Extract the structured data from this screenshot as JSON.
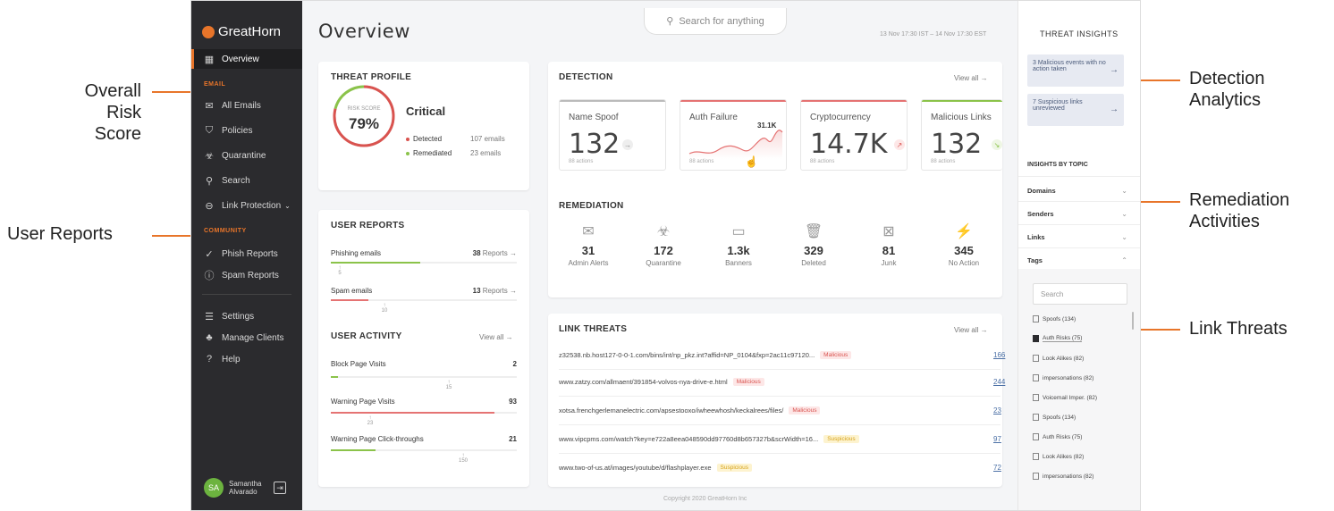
{
  "callouts": {
    "overall_risk": [
      "Overall",
      "Risk Score"
    ],
    "user_reports": "User Reports",
    "detection": [
      "Detection",
      "Analytics"
    ],
    "remediation": [
      "Remediation",
      "Activities"
    ],
    "link_threats": "Link Threats"
  },
  "colors": {
    "accent": "#e8752a",
    "critical": "#d9534f",
    "remediated": "#8bc34a",
    "sidebar": "#2b2b2e"
  },
  "sidebar": {
    "brand": "GreatHorn",
    "overview": "Overview",
    "email_label": "EMAIL",
    "items": [
      {
        "label": "All Emails",
        "icon": "mail-icon"
      },
      {
        "label": "Policies",
        "icon": "shield-icon"
      },
      {
        "label": "Quarantine",
        "icon": "biohazard-icon"
      },
      {
        "label": "Search",
        "icon": "search-icon"
      },
      {
        "label": "Link Protection",
        "icon": "link-icon"
      }
    ],
    "community_label": "COMMUNITY",
    "community_items": [
      {
        "label": "Phish Reports",
        "icon": "hook-icon"
      },
      {
        "label": "Spam Reports",
        "icon": "alert-icon"
      }
    ],
    "bottom_items": [
      {
        "label": "Settings",
        "icon": "sliders-icon"
      },
      {
        "label": "Manage Clients",
        "icon": "org-icon"
      },
      {
        "label": "Help",
        "icon": "help-icon"
      }
    ],
    "user": {
      "initials": "SA",
      "first": "Samantha",
      "last": "Alvarado"
    }
  },
  "header": {
    "title": "Overview",
    "search_placeholder": "Search for anything",
    "date_range": "13 Nov 17:30 IST – 14 Nov 17:30 EST"
  },
  "threat_profile": {
    "title": "THREAT PROFILE",
    "risk_label": "RISK SCORE",
    "risk_value": "79%",
    "risk_fraction": 0.79,
    "level": "Critical",
    "detected_label": "Detected",
    "detected_value": "107 emails",
    "remediated_label": "Remediated",
    "remediated_value": "23 emails"
  },
  "user_reports": {
    "title": "USER REPORTS",
    "rows": [
      {
        "label": "Phishing emails",
        "count": "38",
        "suffix": "Reports →",
        "marker": "5",
        "fill": 0.48,
        "color": "#8bc34a"
      },
      {
        "label": "Spam emails",
        "count": "13",
        "suffix": "Reports →",
        "marker": "10",
        "fill": 0.2,
        "color": "#e57373"
      }
    ]
  },
  "user_activity": {
    "title": "USER ACTIVITY",
    "view_all": "View all →",
    "rows": [
      {
        "label": "Block Page Visits",
        "value": "2",
        "marker": "15",
        "fill": 0.04,
        "color": "#8bc34a"
      },
      {
        "label": "Warning Page Visits",
        "value": "93",
        "marker": "23",
        "fill": 0.88,
        "color": "#e57373"
      },
      {
        "label": "Warning Page Click-throughs",
        "value": "21",
        "marker": "150",
        "fill": 0.24,
        "color": "#8bc34a"
      }
    ]
  },
  "detection": {
    "title": "DETECTION",
    "view_all": "View all →",
    "tiles": [
      {
        "name": "Name Spoof",
        "value": "132",
        "actions": "88 actions",
        "bar": "#bbbbbb",
        "arrow": "→",
        "arrow_color": "#888"
      },
      {
        "name": "Auth Failure",
        "value": "31.1K",
        "actions": "88 actions",
        "bar": "#e57373",
        "arrow": "",
        "arrow_color": "#e57373"
      },
      {
        "name": "Cryptocurrency",
        "value": "14.7K",
        "actions": "88 actions",
        "bar": "#e57373",
        "arrow": "↗",
        "arrow_color": "#e57373"
      },
      {
        "name": "Malicious Links",
        "value": "132",
        "actions": "88 actions",
        "bar": "#8bc34a",
        "arrow": "↘",
        "arrow_color": "#8bc34a"
      }
    ]
  },
  "remediation": {
    "title": "REMEDIATION",
    "items": [
      {
        "value": "31",
        "label": "Admin Alerts",
        "icon": "alert-mail-icon",
        "glyph": "✉"
      },
      {
        "value": "172",
        "label": "Quarantine",
        "icon": "biohazard-icon",
        "glyph": "☣"
      },
      {
        "value": "1.3k",
        "label": "Banners",
        "icon": "banner-icon",
        "glyph": "▭"
      },
      {
        "value": "329",
        "label": "Deleted",
        "icon": "trash-icon",
        "glyph": "🗑"
      },
      {
        "value": "81",
        "label": "Junk",
        "icon": "junk-icon",
        "glyph": "⊠"
      },
      {
        "value": "345",
        "label": "No Action",
        "icon": "bolt-icon",
        "glyph": "⚡"
      }
    ]
  },
  "link_threats": {
    "title": "LINK THREATS",
    "view_all": "View all →",
    "rows": [
      {
        "url": "z32538.nb.host127-0-0-1.com/bins/int/np_pkz.int?affid=NP_0104&fxp=2ac11c97120...",
        "tag": "Malicious",
        "kind": "mal",
        "count": "166"
      },
      {
        "url": "www.zatzy.com/allmaent/391854-volvos-nya-drive-e.html",
        "tag": "Malicious",
        "kind": "mal",
        "count": "244"
      },
      {
        "url": "xotsa.frenchgerlemanelectric.com/apsestooxo/iwheewhosh/keckalrees/files/",
        "tag": "Malicious",
        "kind": "mal",
        "count": "23"
      },
      {
        "url": "www.vipcpms.com/watch?key=e722a8eea048590dd97760d8b657327b&scrWidth=16...",
        "tag": "Suspicious",
        "kind": "sus",
        "count": "97"
      },
      {
        "url": "www.two-of-us.at/images/youtube/d/flashplayer.exe",
        "tag": "Suspicious",
        "kind": "sus",
        "count": "72"
      }
    ]
  },
  "insights": {
    "title": "THREAT INSIGHTS",
    "cards": [
      {
        "text": "3 Malicious events with no action taken"
      },
      {
        "text": "7 Suspicious links unreviewed"
      }
    ],
    "by_topic": "INSIGHTS BY TOPIC",
    "topics": [
      {
        "label": "Domains",
        "chev": "⌄"
      },
      {
        "label": "Senders",
        "chev": "⌄"
      },
      {
        "label": "Links",
        "chev": "⌄"
      },
      {
        "label": "Tags",
        "chev": "⌃"
      }
    ],
    "tag_search": "Search",
    "tags": [
      {
        "label": "Spoofs (134)",
        "checked": false
      },
      {
        "label": "Auth Risks (75)",
        "checked": true
      },
      {
        "label": "Look Alikes (82)",
        "checked": false
      },
      {
        "label": "impersonations (82)",
        "checked": false
      },
      {
        "label": "Voicemail Imper. (82)",
        "checked": false
      },
      {
        "label": "Spoofs (134)",
        "checked": false
      },
      {
        "label": "Auth Risks (75)",
        "checked": false
      },
      {
        "label": "Look Alikes (82)",
        "checked": false
      },
      {
        "label": "impersonations (82)",
        "checked": false
      }
    ]
  },
  "footer": {
    "copyright": "Copyright 2020 GreatHorn Inc"
  }
}
